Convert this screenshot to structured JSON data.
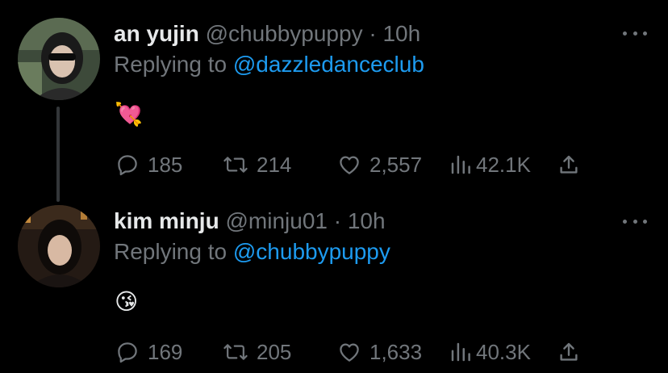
{
  "colors": {
    "link": "#1d9bf0",
    "muted": "#71767b",
    "text": "#e7e9ea",
    "background": "#000000"
  },
  "tweets": [
    {
      "name": "an yujin",
      "handle": "@chubbypuppy",
      "dot": "·",
      "time": "10h",
      "replying_prefix": "Replying to",
      "replying_to": "@dazzledanceclub",
      "content": "💘",
      "replies": "185",
      "retweets": "214",
      "likes": "2,557",
      "views": "42.1K"
    },
    {
      "name": "kim minju",
      "handle": "@minju01",
      "dot": "·",
      "time": "10h",
      "replying_prefix": "Replying to",
      "replying_to": "@chubbypuppy",
      "content": "😘",
      "replies": "169",
      "retweets": "205",
      "likes": "1,633",
      "views": "40.3K"
    }
  ]
}
